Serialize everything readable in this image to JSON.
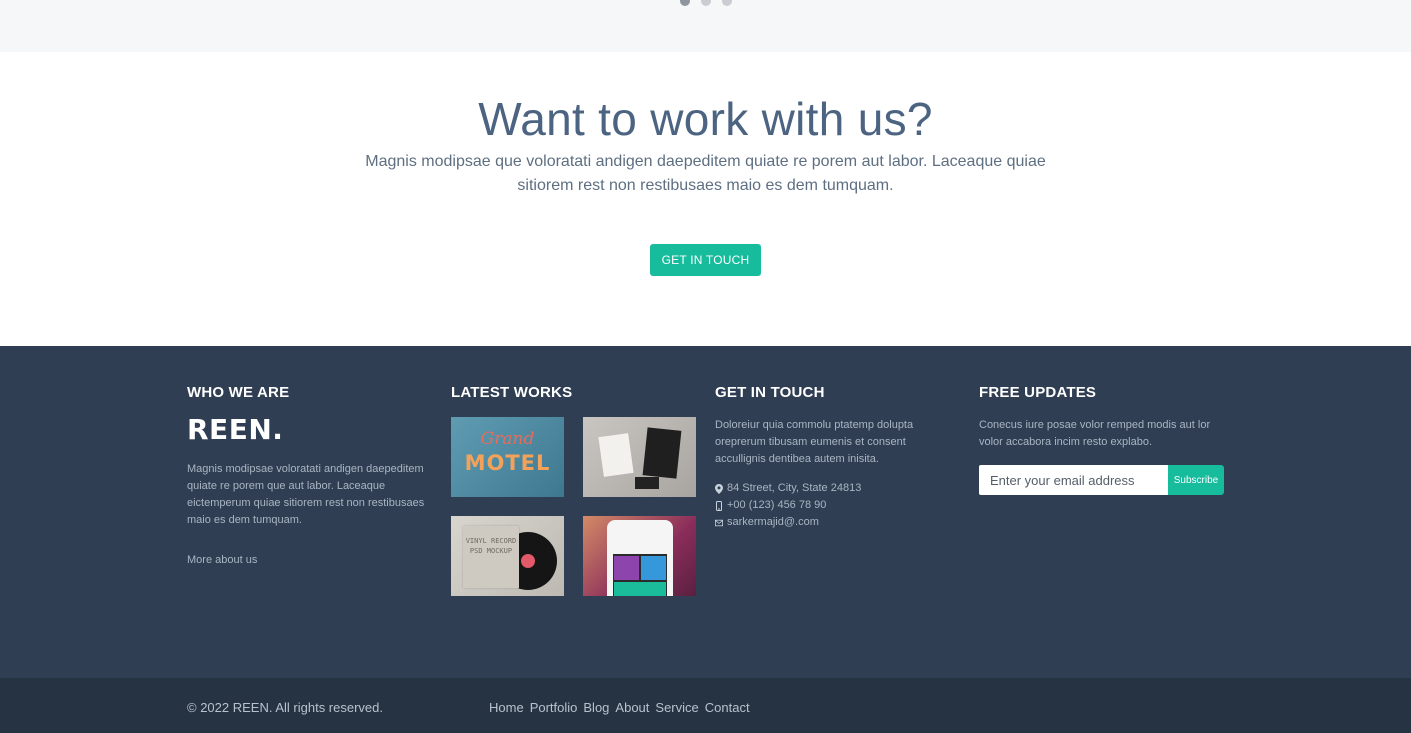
{
  "colors": {
    "accent": "#17bc9c",
    "heading": "#4c6482",
    "footer_bg": "#2f3e52",
    "bottom_bar_bg": "#263343"
  },
  "carousel": {
    "dots": 3,
    "active_index": 0
  },
  "cta": {
    "title": "Want to work with us?",
    "text": "Magnis modipsae que voloratati andigen daepeditem quiate re porem aut labor. Laceaque quiae sitiorem rest non restibusaes maio es dem tumquam.",
    "button_label": "GET IN TOUCH"
  },
  "footer": {
    "who_we_are": {
      "heading": "WHO WE ARE",
      "logo": "REEN.",
      "text": "Magnis modipsae voloratati andigen daepeditem quiate re porem que aut labor. Laceaque eictemperum quiae sitiorem rest non restibusaes maio es dem tumquam.",
      "link": "More about us"
    },
    "latest_works": {
      "heading": "LATEST WORKS",
      "items": [
        {
          "title_a": "Grand",
          "title_b": "MOTEL"
        },
        {
          "title": "Stationery mockup"
        },
        {
          "sleeve_text": "VINYL RECORD PSD MOCKUP"
        },
        {
          "title": "App mockup"
        }
      ]
    },
    "get_in_touch": {
      "heading": "GET IN TOUCH",
      "text": "Doloreiur quia commolu ptatemp dolupta oreprerum tibusam eumenis et consent accullignis dentibea autem inisita.",
      "address": "84 Street, City, State 24813",
      "phone": "+00 (123) 456 78 90",
      "email": "sarkermajid@.com",
      "icons": {
        "address": "map-marker-icon",
        "phone": "mobile-phone-icon",
        "email": "envelope-icon"
      }
    },
    "free_updates": {
      "heading": "FREE UPDATES",
      "text": "Conecus iure posae volor remped modis aut lor volor accabora incim resto explabo.",
      "placeholder": "Enter your email address",
      "button_label": "Subscribe"
    }
  },
  "bottom": {
    "copyright": "© 2022 REEN. All rights reserved.",
    "nav": [
      "Home",
      "Portfolio",
      "Blog",
      "About",
      "Service",
      "Contact"
    ]
  }
}
